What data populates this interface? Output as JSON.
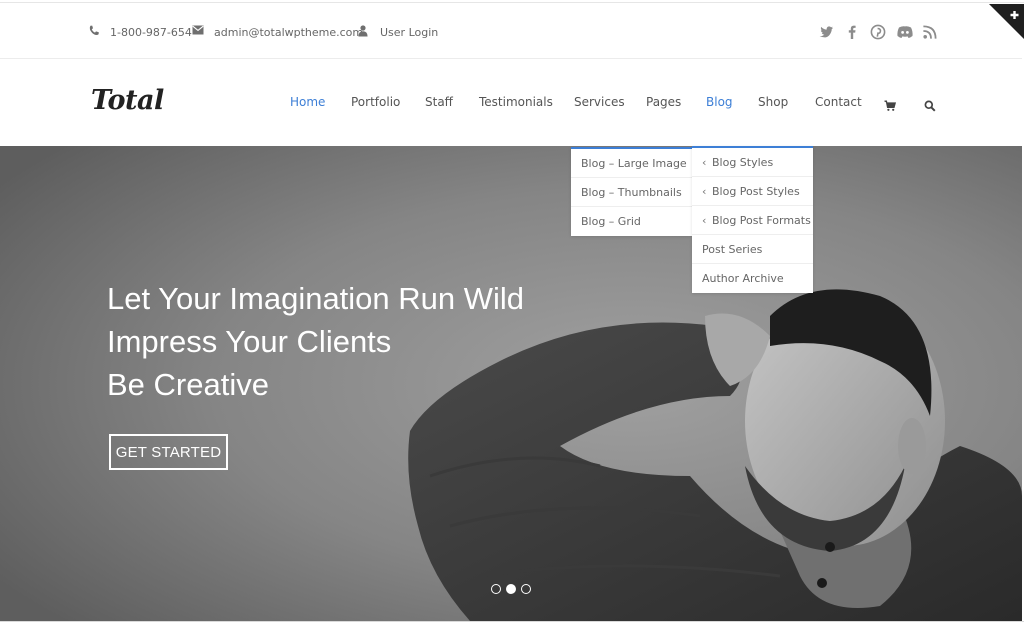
{
  "topbar": {
    "phone": "1-800-987-654",
    "email": "admin@totalwptheme.com",
    "login": "User Login",
    "phone_icon": "phone-icon",
    "email_icon": "envelope-icon",
    "login_icon": "user-icon",
    "social": [
      "twitter-icon",
      "facebook-icon",
      "pinterest-icon",
      "discord-icon",
      "rss-icon"
    ]
  },
  "header": {
    "logo": "Total",
    "nav": [
      {
        "label": "Home",
        "active": true
      },
      {
        "label": "Portfolio"
      },
      {
        "label": "Staff"
      },
      {
        "label": "Testimonials"
      },
      {
        "label": "Services"
      },
      {
        "label": "Pages"
      },
      {
        "label": "Blog",
        "active": true
      },
      {
        "label": "Shop"
      },
      {
        "label": "Contact"
      }
    ],
    "cart_icon": "cart-icon",
    "search_icon": "search-icon"
  },
  "blog_menu": {
    "left_items": [
      "Blog – Large Image",
      "Blog – Thumbnails",
      "Blog – Grid"
    ],
    "right_items": [
      {
        "label": "Blog Styles",
        "has_submenu": true
      },
      {
        "label": "Blog Post Styles",
        "has_submenu": true
      },
      {
        "label": "Blog Post Formats",
        "has_submenu": true
      },
      {
        "label": "Post Series",
        "has_submenu": false
      },
      {
        "label": "Author Archive",
        "has_submenu": false
      }
    ]
  },
  "hero": {
    "lines": [
      "Let Your Imagination Run Wild",
      "Impress Your Clients",
      "Be Creative"
    ],
    "button": "GET STARTED",
    "slides": 3,
    "active_slide": 2
  },
  "colors": {
    "accent": "#3d7fd6",
    "corner": "#1f1f1f"
  }
}
